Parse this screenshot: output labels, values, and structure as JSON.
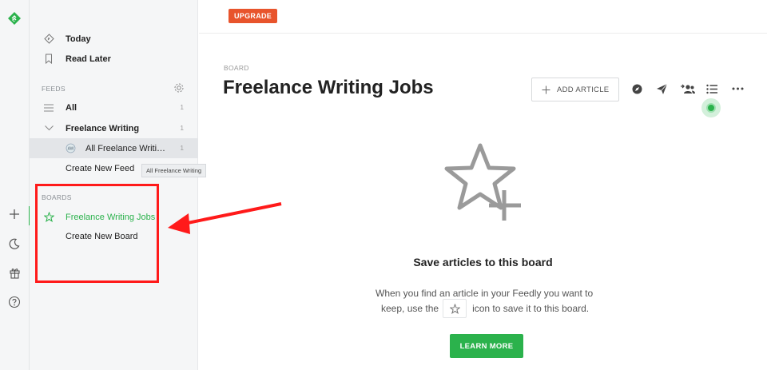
{
  "rail": {
    "icons": [
      "feedly-logo-icon",
      "plus-icon",
      "moon-icon",
      "gift-icon",
      "help-icon"
    ]
  },
  "sidebar": {
    "top_items": [
      {
        "label": "Today",
        "icon": "today-icon"
      },
      {
        "label": "Read Later",
        "icon": "bookmark-icon"
      }
    ],
    "feeds_section": "FEEDS",
    "feeds": [
      {
        "label": "All",
        "count": "1"
      },
      {
        "label": "Freelance Writing",
        "count": "1"
      },
      {
        "label": "All Freelance Writi…",
        "count": "1"
      }
    ],
    "create_feed": "Create New Feed",
    "tooltip": "All Freelance Writing",
    "boards_section": "BOARDS",
    "boards": [
      {
        "label": "Freelance Writing Jobs"
      }
    ],
    "create_board": "Create New Board"
  },
  "topbar": {
    "upgrade_label": "UPGRADE"
  },
  "main": {
    "breadcrumb": "BOARD",
    "title": "Freelance Writing Jobs",
    "add_article_label": "ADD ARTICLE",
    "toolbar_icons": [
      "compass-icon",
      "send-icon",
      "share-people-icon",
      "list-view-icon",
      "more-icon"
    ],
    "empty_title": "Save articles to this board",
    "empty_line1": "When you find an article in your Feedly you want to",
    "empty_line2a": "keep, use the",
    "empty_line2b": "icon to save it to this board.",
    "learn_more_label": "LEARN MORE"
  },
  "colors": {
    "accent_green": "#2bb24c",
    "upgrade_orange": "#e8542c",
    "annotation_red": "#ff1a1a"
  }
}
